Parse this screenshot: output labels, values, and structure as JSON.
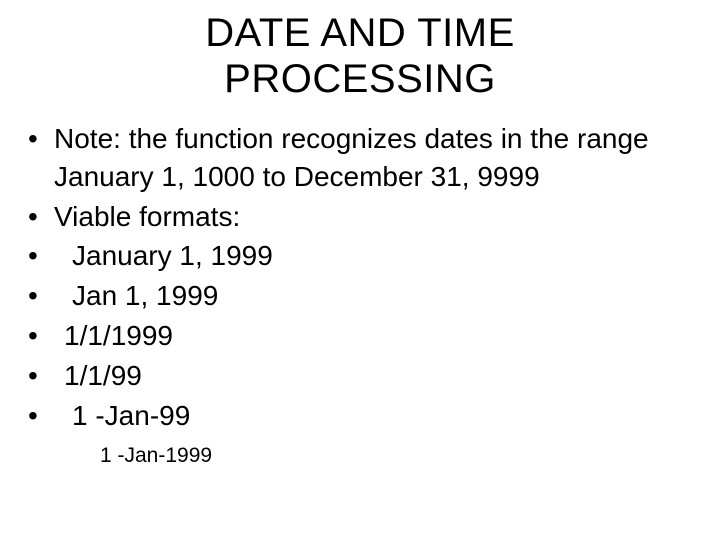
{
  "title_line1": "DATE AND TIME",
  "title_line2": "PROCESSING",
  "bullets": {
    "b0": "Note: the function recognizes dates in the range January 1, 1000 to December 31, 9999",
    "b1": "Viable formats:",
    "b2": "January 1, 1999",
    "b3": "Jan 1, 1999",
    "b4": "1/1/1999",
    "b5": "1/1/99",
    "b6": "1 -Jan-99"
  },
  "trailing": "1 -Jan-1999"
}
